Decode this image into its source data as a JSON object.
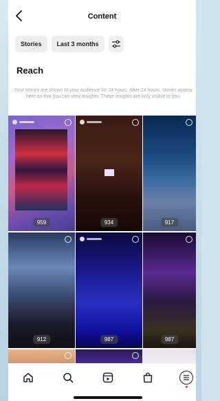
{
  "header": {
    "title": "Content",
    "back_icon": "chevron-left-icon"
  },
  "filters": [
    {
      "label": "Stories"
    },
    {
      "label": "Last 3 months"
    },
    {
      "icon": "sliders-icon"
    }
  ],
  "section": {
    "title": "Reach",
    "description": "Your stories are shown to your audience for 24 hours. After 24 hours, stories appear here so that you can view insights. These insights are only visible to you."
  },
  "stories": [
    {
      "reach": "959"
    },
    {
      "reach": "934"
    },
    {
      "reach": "917"
    },
    {
      "reach": "912"
    },
    {
      "reach": "987"
    },
    {
      "reach": "987"
    }
  ],
  "tabbar": [
    {
      "icon": "home-icon"
    },
    {
      "icon": "search-icon"
    },
    {
      "icon": "reels-icon"
    },
    {
      "icon": "shop-icon"
    },
    {
      "icon": "profile-icon",
      "active": true
    }
  ],
  "colors": {
    "accent_dot": "#e0245e",
    "chip_bg": "#efefef",
    "muted_text": "#a6a6a6"
  }
}
